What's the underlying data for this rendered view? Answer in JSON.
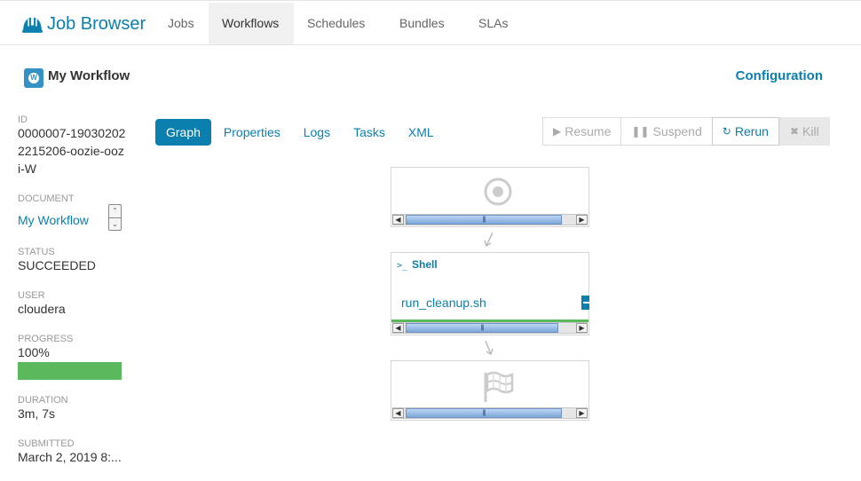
{
  "app": {
    "title": "Job Browser"
  },
  "nav": {
    "jobs": "Jobs",
    "workflows": "Workflows",
    "schedules": "Schedules",
    "bundles": "Bundles",
    "slas": "SLAs"
  },
  "header": {
    "icon_letter": "W",
    "title": "My Workflow",
    "config_link": "Configuration"
  },
  "sidebar": {
    "id_label": "ID",
    "id_value": "0000007-190302022215206-oozie-oozi-W",
    "document_label": "DOCUMENT",
    "document_value": "My Workflow",
    "status_label": "STATUS",
    "status_value": "SUCCEEDED",
    "user_label": "USER",
    "user_value": "cloudera",
    "progress_label": "PROGRESS",
    "progress_value": "100%",
    "progress_fraction": 1.0,
    "duration_label": "DURATION",
    "duration_value": "3m, 7s",
    "submitted_label": "SUBMITTED",
    "submitted_value": "March 2, 2019 8:..."
  },
  "tabs": {
    "graph": "Graph",
    "properties": "Properties",
    "logs": "Logs",
    "tasks": "Tasks",
    "xml": "XML"
  },
  "actions": {
    "resume": "Resume",
    "suspend": "Suspend",
    "rerun": "Rerun",
    "kill": "Kill"
  },
  "graph": {
    "shell_node": {
      "prompt": ">_",
      "type": "Shell",
      "script": "run_cleanup.sh"
    },
    "scroll_grip": "|||"
  },
  "colors": {
    "accent": "#0B7FAD",
    "success": "#5cb85c"
  }
}
